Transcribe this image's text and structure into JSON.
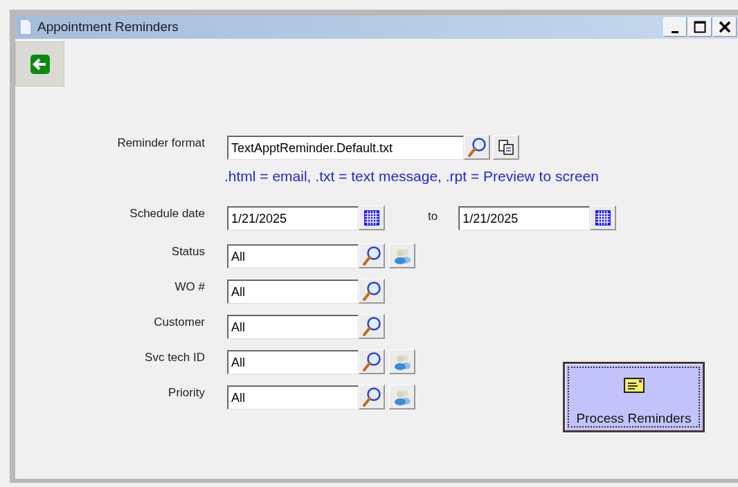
{
  "window": {
    "title": "Appointment Reminders"
  },
  "reminder_format": {
    "label": "Reminder format",
    "value": "TextApptReminder.Default.txt",
    "hint": ".html = email, .txt = text message, .rpt = Preview to screen"
  },
  "schedule_date": {
    "label": "Schedule date",
    "from": "1/21/2025",
    "to_label": "to",
    "to": "1/21/2025"
  },
  "filters": [
    {
      "label": "Status",
      "value": "All",
      "kind": "lookup-people"
    },
    {
      "label": "WO #",
      "value": "All",
      "kind": "lookup"
    },
    {
      "label": "Customer",
      "value": "All",
      "kind": "lookup"
    },
    {
      "label": "Svc tech ID",
      "value": "All",
      "kind": "lookup-people"
    },
    {
      "label": "Priority",
      "value": "All",
      "kind": "lookup-people"
    }
  ],
  "process_button": {
    "label": "Process Reminders",
    "focused": true
  }
}
